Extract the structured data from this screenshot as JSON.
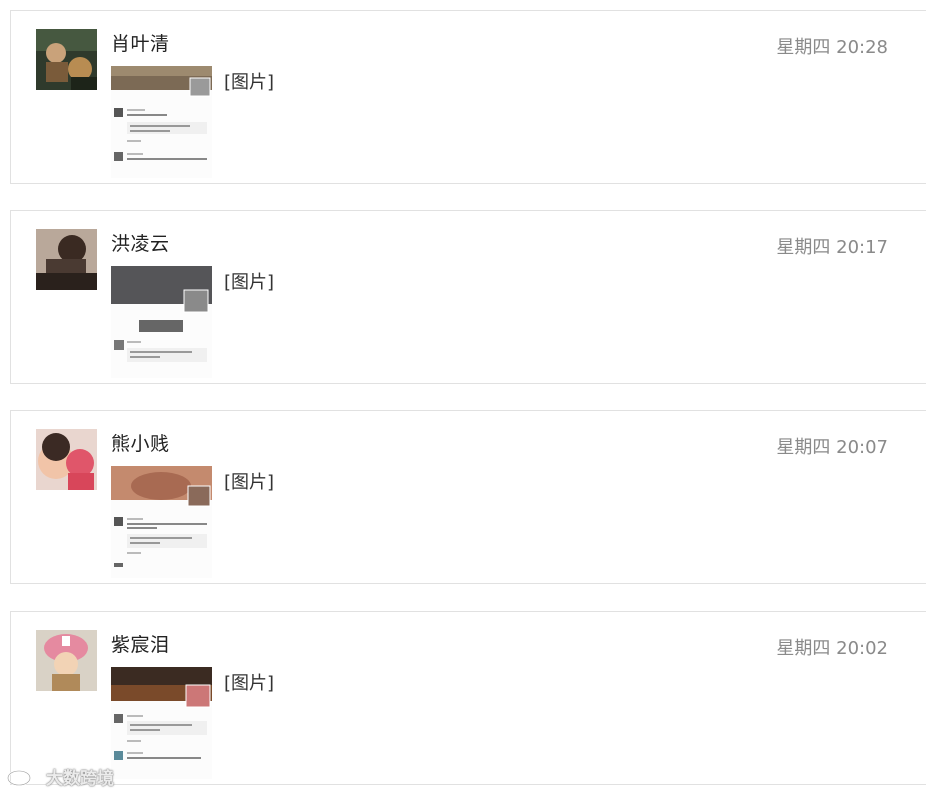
{
  "content_label": "[图片]",
  "messages": [
    {
      "name": "肖叶清",
      "time": "星期四 20:28",
      "content": "[图片]"
    },
    {
      "name": "洪凌云",
      "time": "星期四 20:17",
      "content": "[图片]"
    },
    {
      "name": "熊小贱",
      "time": "星期四 20:07",
      "content": "[图片]"
    },
    {
      "name": "紫宸泪",
      "time": "星期四 20:02",
      "content": "[图片]"
    }
  ],
  "watermark": {
    "text": "大数跨境"
  }
}
